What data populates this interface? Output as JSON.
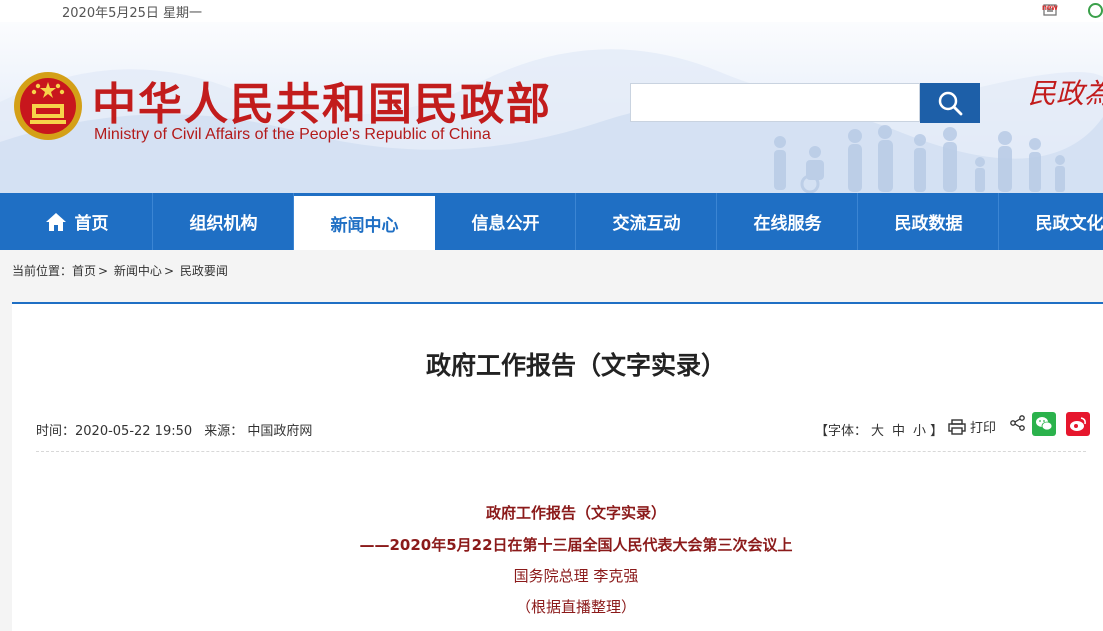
{
  "topbar": {
    "date": "2020年5月25日 星期一",
    "new_badge": "new"
  },
  "header": {
    "title": "中华人民共和国民政部",
    "subtitle": "Ministry of Civil Affairs of the People's Republic of China",
    "search_placeholder": "",
    "calligraphy": "民政為"
  },
  "nav": {
    "items": [
      {
        "label": "首页"
      },
      {
        "label": "组织机构"
      },
      {
        "label": "新闻中心"
      },
      {
        "label": "信息公开"
      },
      {
        "label": "交流互动"
      },
      {
        "label": "在线服务"
      },
      {
        "label": "民政数据"
      },
      {
        "label": "民政文化"
      }
    ],
    "active_index": 2
  },
  "breadcrumb": {
    "prefix": "当前位置：",
    "items": [
      "首页",
      "新闻中心",
      "民政要闻"
    ]
  },
  "article": {
    "title": "政府工作报告（文字实录）",
    "time": "时间：2020-05-22 19:50",
    "source": "来源： 中国政府网",
    "font_label": "【字体：",
    "font_sizes": [
      "大",
      "中",
      "小"
    ],
    "font_close": "】",
    "print_label": "打印",
    "body": {
      "title": "政府工作报告（文字实录）",
      "subtitle": "——2020年5月22日在第十三届全国人民代表大会第三次会议上",
      "speaker": "国务院总理 李克强",
      "note": "（根据直播整理）"
    }
  },
  "colors": {
    "nav_bg": "#1f6fc4",
    "title_red": "#c21c1c",
    "body_red": "#8b1a1a",
    "search_button": "#1d5fa8"
  }
}
